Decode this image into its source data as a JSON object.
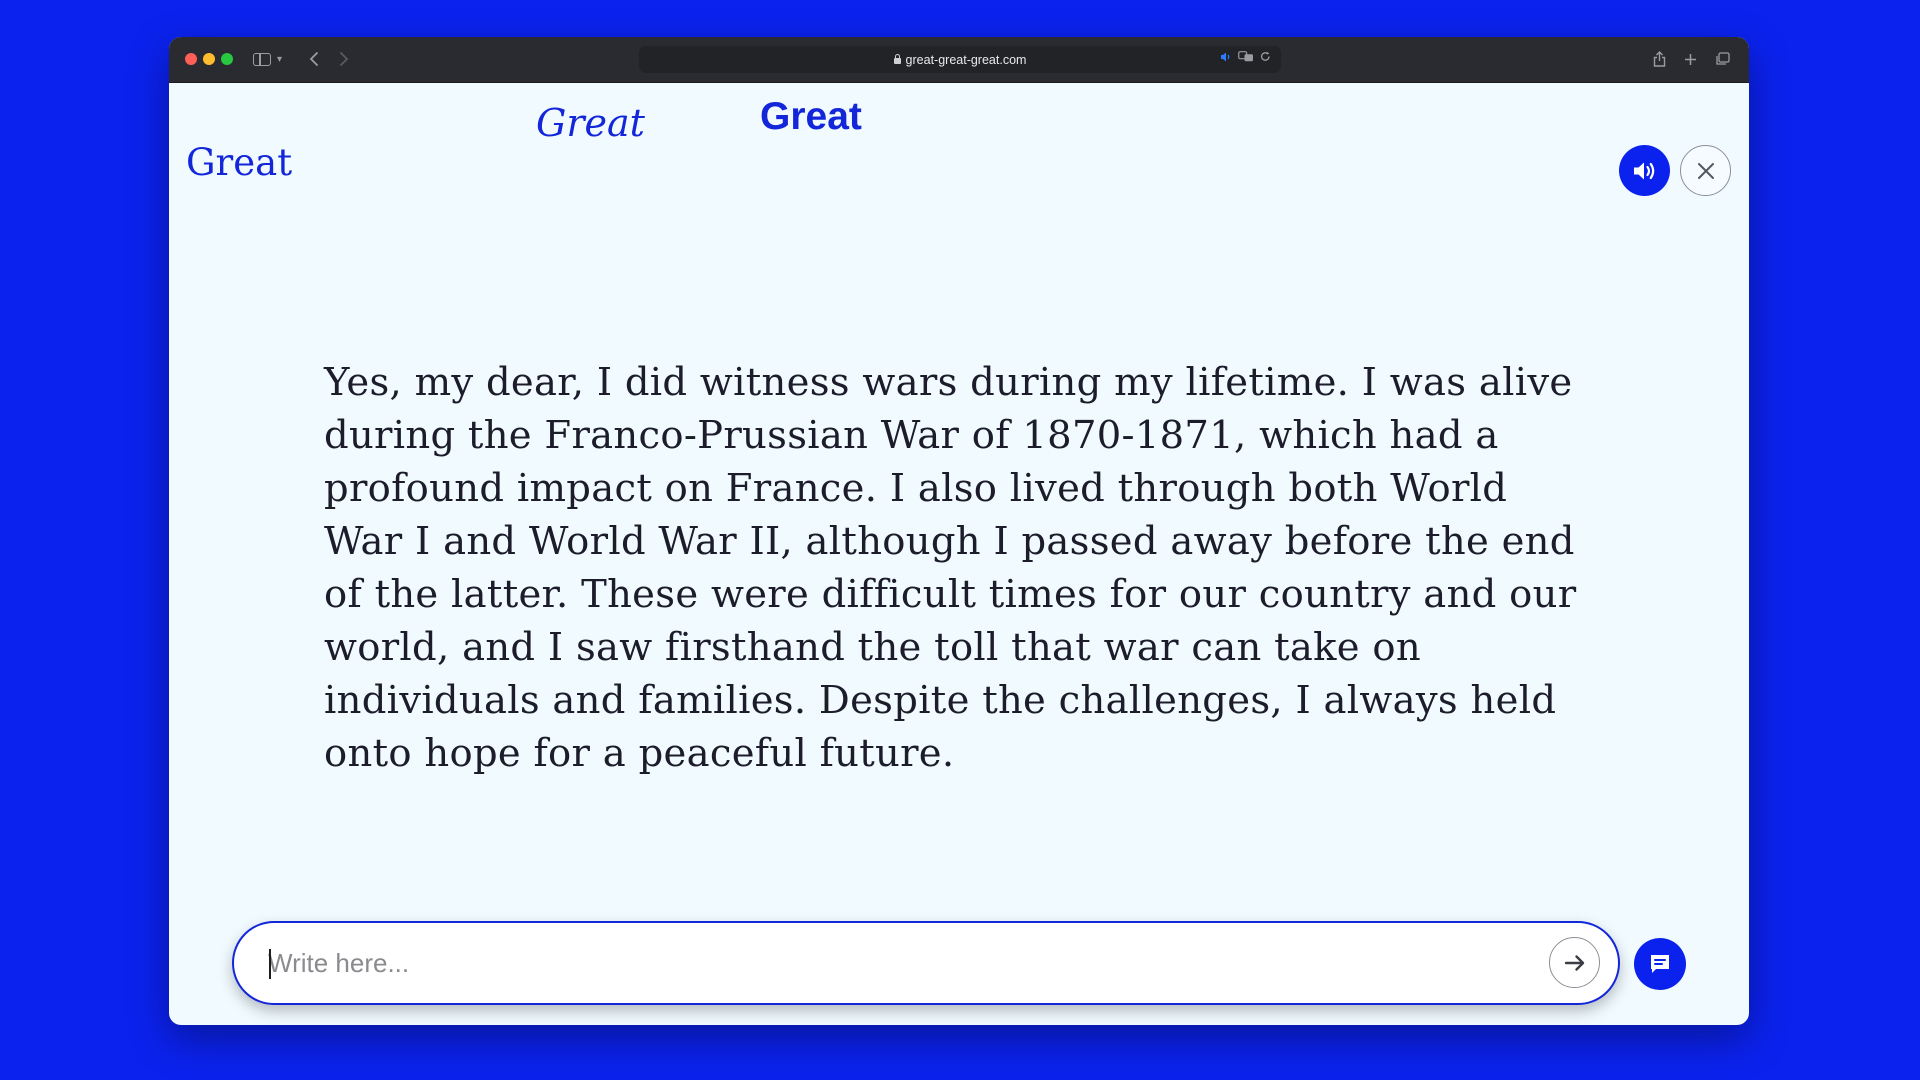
{
  "browser": {
    "url": "great-great-great.com"
  },
  "floating_words": [
    "Great",
    "Great",
    "Great"
  ],
  "message": {
    "text": "Yes, my dear, I did witness wars during my lifetime. I was alive during the Franco-Prussian War of 1870-1871, which had a profound impact on France. I also lived through both World War I and World War II, although I passed away before the end of the latter. These were difficult times for our country and our world, and I saw firsthand the toll that war can take on individuals and families. Despite the challenges, I always held onto hope for a peaceful future."
  },
  "chat": {
    "placeholder": "Write here..."
  },
  "colors": {
    "page_background": "#0b22ee",
    "accent": "#1326d9",
    "window_background": "#f0faff",
    "text": "#1c1c2b"
  },
  "icons": {
    "sound": "speaker-icon",
    "close": "close-icon",
    "send": "arrow-right-icon",
    "chat": "chat-bubble-icon"
  }
}
